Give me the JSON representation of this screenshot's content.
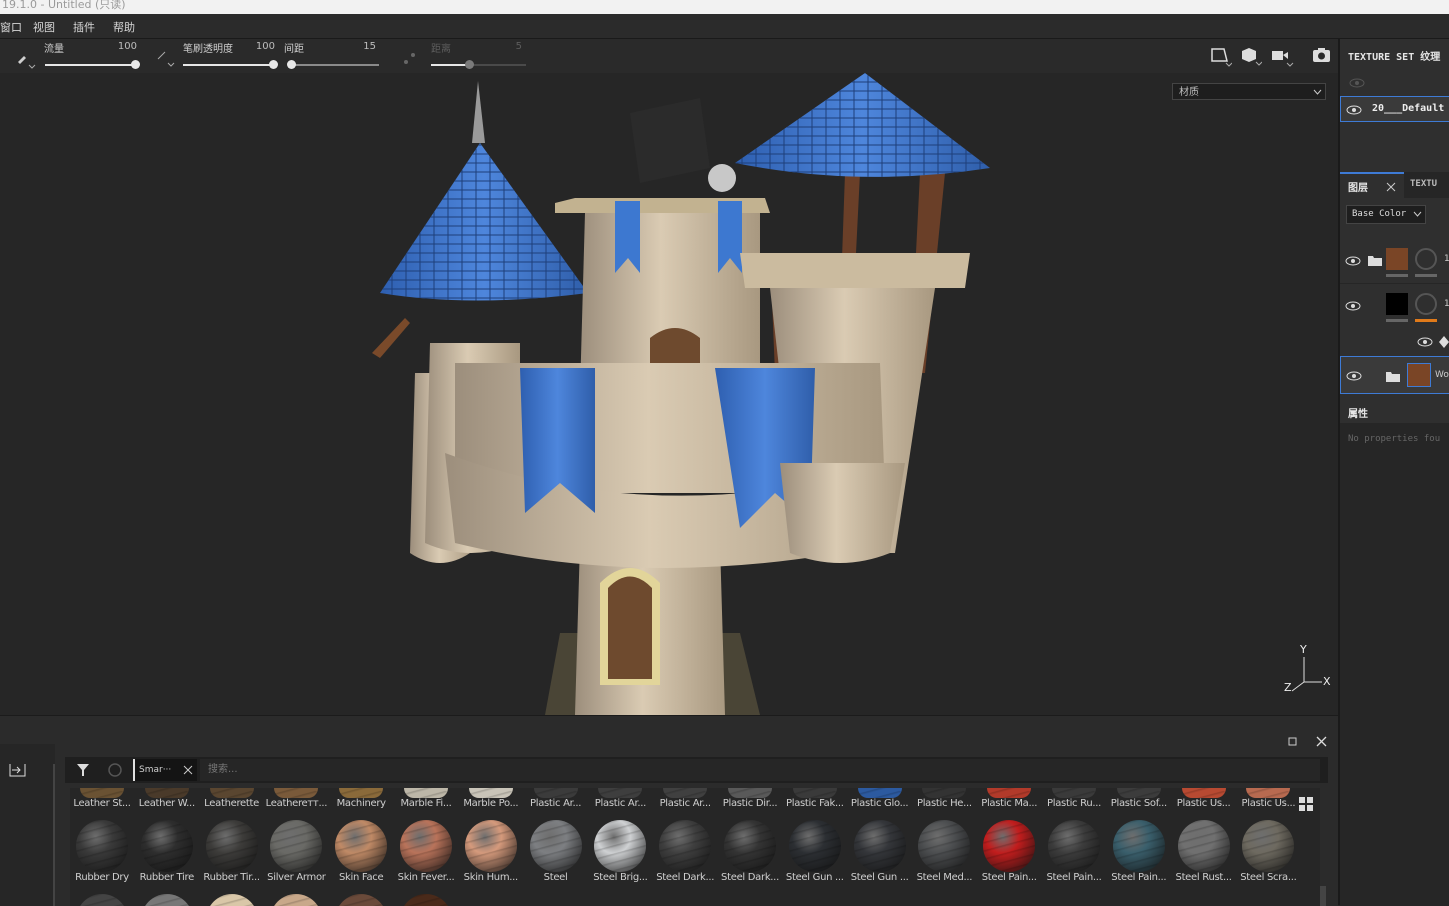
{
  "titlebar": {
    "text": "19.1.0 - Untitled (只读)"
  },
  "menu": {
    "items": [
      "窗口",
      "视图",
      "插件",
      "帮助"
    ]
  },
  "toolbar": {
    "flow": {
      "label": "流量",
      "value": "100",
      "level": 1.0
    },
    "opacity": {
      "label": "笔刷透明度",
      "value": "100",
      "level": 1.0
    },
    "spacing": {
      "label": "间距",
      "value": "15",
      "level": 0.0
    },
    "distance": {
      "label": "距离",
      "value": "5",
      "level": 0.4
    }
  },
  "viewport": {
    "material_mode": "材质",
    "axes": {
      "x": "X",
      "y": "Y",
      "z": "Z"
    }
  },
  "texture_set": {
    "title": "TEXTURE SET 纹理",
    "item": "20___Default"
  },
  "layers": {
    "tab_layers": "图层",
    "tab_texture": "TEXTU",
    "channel": "Base Color",
    "layer1_letter": "1",
    "layer2_letter": "1",
    "layer3_label": "Woo"
  },
  "properties": {
    "title": "属性",
    "empty": "No properties fou"
  },
  "shelf": {
    "tab": "Smar···",
    "search_placeholder": "搜索...",
    "row1": [
      "Leather St...",
      "Leather W...",
      "Leatherette",
      "Leathereтт...",
      "Machinery",
      "Marble Fi...",
      "Marble Po...",
      "Plastic Ar...",
      "Plastic Ar...",
      "Plastic Ar...",
      "Plastic Dir...",
      "Plastic Fak...",
      "Plastic Glo...",
      "Plastic He...",
      "Plastic Ma...",
      "Plastic Ru...",
      "Plastic Sof...",
      "Plastic Us...",
      "Plastic Us..."
    ],
    "row2": [
      "Rubber Dry",
      "Rubber Tire",
      "Rubber Tir...",
      "Silver Armor",
      "Skin Face",
      "Skin Fever...",
      "Skin Hum...",
      "Steel",
      "Steel Brig...",
      "Steel Dark...",
      "Steel Dark...",
      "Steel Gun ...",
      "Steel Gun ...",
      "Steel Med...",
      "Steel Pain...",
      "Steel Pain...",
      "Steel Pain...",
      "Steel Rust...",
      "Steel Scra..."
    ],
    "row2_colors": [
      "#3a3a3a",
      "#2e2e2e",
      "#3d3c3a",
      "#6a6a66",
      "#c08a66",
      "#b9735a",
      "#d59a7c",
      "#7d7f82",
      "#cfd1d3",
      "#3f3f3f",
      "#343434",
      "#2c2f33",
      "#34363a",
      "#4c4e50",
      "#c21d1d",
      "#3c3c3c",
      "#3a5f6c",
      "#707070",
      "#6e6a60"
    ],
    "row1_colors": [
      "#6a5233",
      "#4a3a2a",
      "#5a4630",
      "#7a5a3a",
      "#8a6a3a",
      "#bdb7a8",
      "#c9c4b8",
      "#3b3b3b",
      "#3e3e3e",
      "#404040",
      "#595959",
      "#3a3a3a",
      "#2c5aa0",
      "#333333",
      "#b23a2a",
      "#3a3a3a",
      "#3c3c3c",
      "#b84a32",
      "#b86a50"
    ]
  }
}
